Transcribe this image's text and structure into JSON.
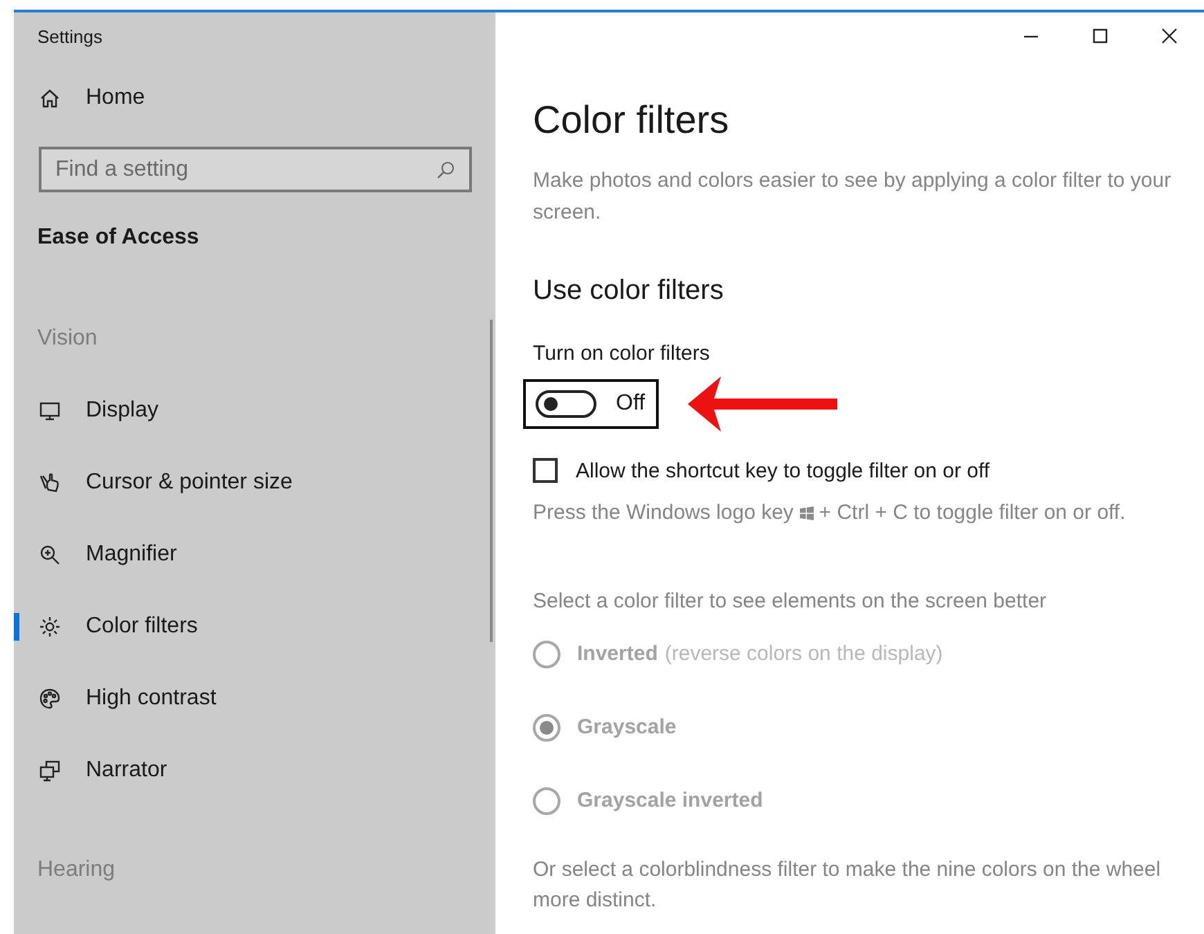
{
  "window": {
    "title": "Settings",
    "controls": [
      {
        "kind": "minimize"
      },
      {
        "kind": "maximize"
      },
      {
        "kind": "close"
      }
    ]
  },
  "sidebar": {
    "home": "Home",
    "search": {
      "placeholder": "Find a setting"
    },
    "category": "Ease of Access",
    "groups": [
      {
        "title": "Vision",
        "items": [
          {
            "label": "Display",
            "kind": "display",
            "selected": false
          },
          {
            "label": "Cursor & pointer size",
            "kind": "cursor",
            "selected": false
          },
          {
            "label": "Magnifier",
            "kind": "magnifier",
            "selected": false
          },
          {
            "label": "Color filters",
            "kind": "sun",
            "selected": true
          },
          {
            "label": "High contrast",
            "kind": "palette",
            "selected": false
          },
          {
            "label": "Narrator",
            "kind": "narrator",
            "selected": false
          }
        ]
      },
      {
        "title": "Hearing"
      }
    ]
  },
  "content": {
    "title": "Color filters",
    "description": "Make photos and colors easier to see by applying a color filter to your screen.",
    "section_title": "Use color filters",
    "toggle": {
      "label": "Turn on color filters",
      "on": false,
      "state_text": "Off",
      "focused": true
    },
    "checkbox": {
      "label": "Allow the shortcut key to toggle filter on or off",
      "checked": false
    },
    "hint": {
      "before": "Press the Windows logo key",
      "after": "+ Ctrl + C to toggle filter on or off."
    },
    "filter_prompt": "Select a color filter to see elements on the screen better",
    "radios": {
      "disabled": true,
      "options": [
        {
          "label": "Inverted",
          "note": "(reverse colors on the display)",
          "selected": false
        },
        {
          "label": "Grayscale",
          "selected": true
        },
        {
          "label": "Grayscale inverted",
          "selected": false
        }
      ]
    },
    "colorblind_text": "Or select a colorblindness filter to make the nine colors on the wheel more distinct."
  }
}
